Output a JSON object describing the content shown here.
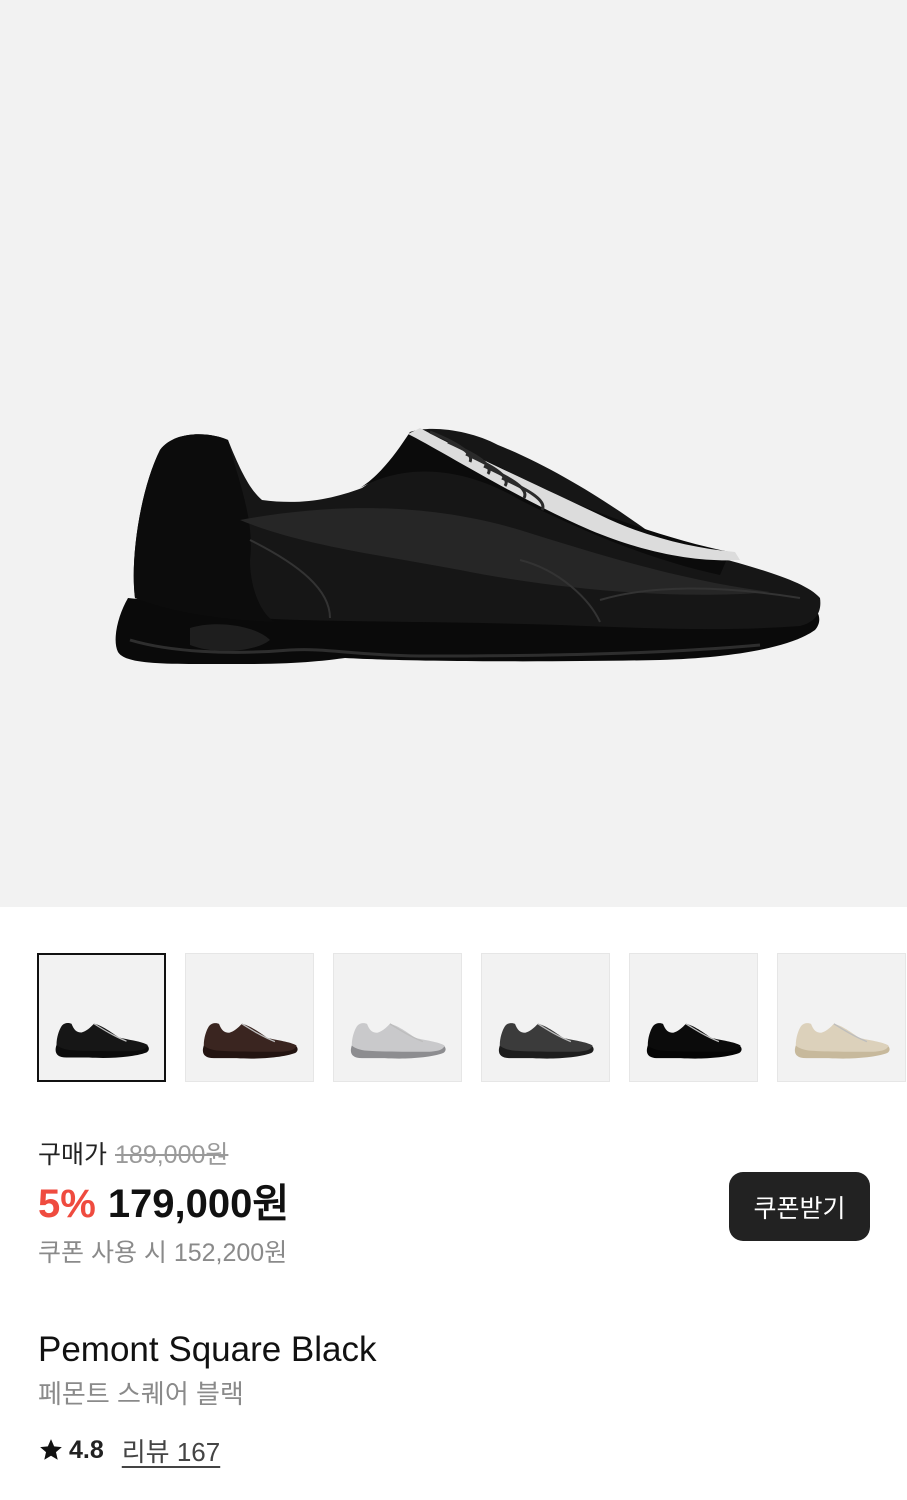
{
  "thumbnails": [
    {
      "name": "black-leather",
      "color": "#161616",
      "sole": "#0c0c0c",
      "selected": true
    },
    {
      "name": "brown",
      "color": "#3a2520",
      "sole": "#231411",
      "selected": false
    },
    {
      "name": "silver",
      "color": "#c9c9cb",
      "sole": "#8d8d90",
      "selected": false
    },
    {
      "name": "dark-grey",
      "color": "#3b3b3b",
      "sole": "#1d1d1d",
      "selected": false
    },
    {
      "name": "black-suede",
      "color": "#0b0b0b",
      "sole": "#050505",
      "selected": false
    },
    {
      "name": "beige",
      "color": "#dcd1bb",
      "sole": "#c7b99c",
      "selected": false
    }
  ],
  "price": {
    "list_label": "구매가",
    "list_value": "189,000원",
    "discount": "5%",
    "sale_value": "179,000원",
    "coupon_text": "쿠폰 사용 시 152,200원"
  },
  "coupon_button": "쿠폰받기",
  "product": {
    "name_en": "Pemont Square Black",
    "name_ko": "페몬트 스퀘어 블랙"
  },
  "rating": {
    "value": "4.8",
    "reviews": "리뷰 167"
  },
  "colors": {
    "hero_bg": "#f2f2f2",
    "discount": "#ef4b3f",
    "button_bg": "#222222"
  }
}
